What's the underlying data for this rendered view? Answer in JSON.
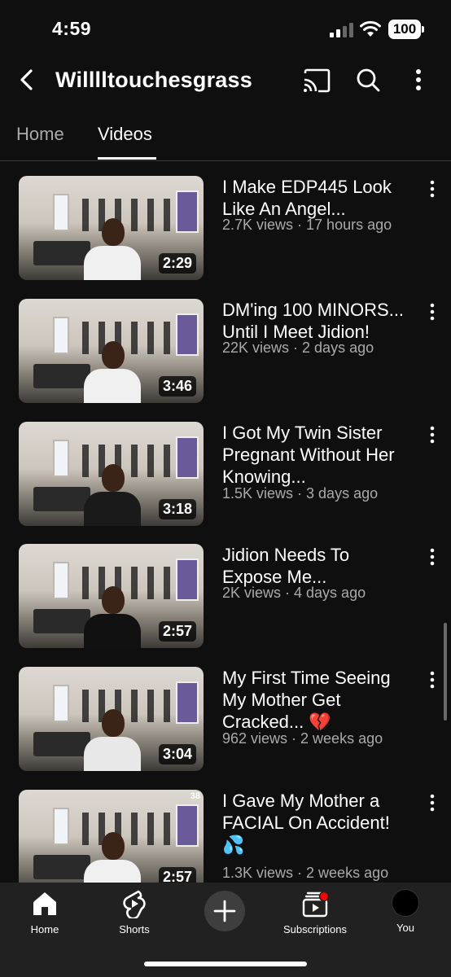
{
  "status_bar": {
    "time": "4:59",
    "battery": "100"
  },
  "header": {
    "channel_title": "Willlltouchesgrass"
  },
  "tabs": [
    {
      "label": "Home",
      "active": false
    },
    {
      "label": "Videos",
      "active": true
    }
  ],
  "videos": [
    {
      "title_line1": "I Make EDP445 Look",
      "title_line2": "Like An Angel...",
      "title_line3": "",
      "meta": "2.7K views · 17 hours ago",
      "duration": "2:29",
      "badge": ""
    },
    {
      "title_line1": "DM'ing 100 MINORS...",
      "title_line2": "Until I Meet Jidion!",
      "title_line3": "",
      "meta": "22K views · 2 days ago",
      "duration": "3:46",
      "badge": ""
    },
    {
      "title_line1": "I Got My Twin Sister",
      "title_line2": "Pregnant Without Her",
      "title_line3": "Knowing...",
      "meta": "1.5K views · 3 days ago",
      "duration": "3:18",
      "badge": ""
    },
    {
      "title_line1": "Jidion Needs To",
      "title_line2": "Expose Me...",
      "title_line3": "",
      "meta": "2K views · 4 days ago",
      "duration": "2:57",
      "badge": ""
    },
    {
      "title_line1": "My First Time Seeing",
      "title_line2": "My Mother Get",
      "title_line3": "Cracked... 💔",
      "meta": "962 views · 2 weeks ago",
      "duration": "3:04",
      "badge": ""
    },
    {
      "title_line1": "I Gave My Mother a",
      "title_line2": "FACIAL On Accident!",
      "title_line3": "💦",
      "meta": "1.3K views · 2 weeks ago",
      "duration": "2:57",
      "badge": "38"
    }
  ],
  "bottom_nav": [
    {
      "label": "Home",
      "icon": "home-icon",
      "active": true
    },
    {
      "label": "Shorts",
      "icon": "shorts-icon",
      "active": false
    },
    {
      "label": "",
      "icon": "create-icon",
      "active": false
    },
    {
      "label": "Subscriptions",
      "icon": "subscriptions-icon",
      "active": false
    },
    {
      "label": "You",
      "icon": "avatar",
      "active": false
    }
  ],
  "colors": {
    "background": "#0f0f0f",
    "nav_background": "#212121",
    "secondary_text": "#aaaaaa",
    "notification_dot": "#ff0000"
  }
}
